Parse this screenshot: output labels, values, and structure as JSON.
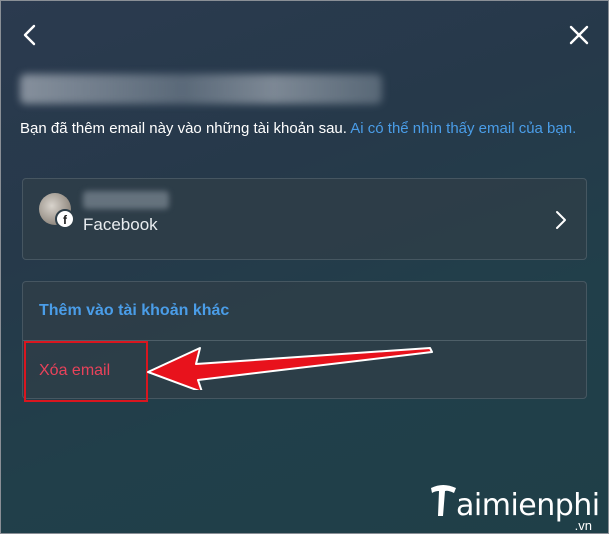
{
  "nav": {
    "back_icon": "chevron-left-icon",
    "close_icon": "close-icon"
  },
  "intro": {
    "text": "Bạn đã thêm email này vào những tài khoản sau. ",
    "link": "Ai có thể nhìn thấy email của bạn."
  },
  "account": {
    "platform": "Facebook",
    "badge_letter": "f"
  },
  "actions": {
    "add_label": "Thêm vào tài khoản khác",
    "delete_label": "Xóa email"
  },
  "watermark": {
    "brand": "aimienphi",
    "suffix": ".vn"
  },
  "colors": {
    "link": "#4a9de8",
    "danger": "#e8425a",
    "annotation": "#d9161f"
  }
}
